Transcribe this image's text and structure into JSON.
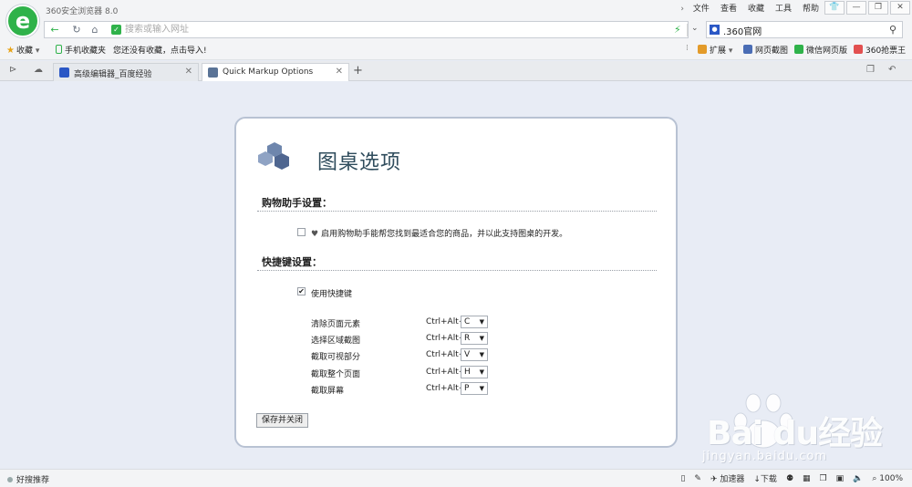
{
  "window": {
    "app_title": "360安全浏览器 8.0",
    "menu": [
      "文件",
      "查看",
      "收藏",
      "工具",
      "帮助"
    ]
  },
  "address": {
    "placeholder": "搜索或输入网址",
    "search_engine_text": ".360官网"
  },
  "bookmarks": {
    "favorites_label": "收藏",
    "mobile_label": "手机收藏夹",
    "hint": "您还没有收藏，点击导入!",
    "extensions_label": "扩展",
    "screenshot_label": "网页截图",
    "wechat_label": "微信网页版",
    "ticket_label": "360抢票王"
  },
  "tabs": [
    {
      "title": "高级编辑器_百度经验"
    },
    {
      "title": "Quick Markup Options"
    }
  ],
  "panel": {
    "title": "图桌选项",
    "shopping_section": "购物助手设置：",
    "shopping_option": "启用购物助手能帮您找到最适合您的商品，并以此支持图桌的开发。",
    "shortcut_section": "快捷键设置：",
    "use_shortcuts": "使用快捷键",
    "shortcuts": [
      {
        "label": "清除页面元素",
        "prefix": "Ctrl+Alt+",
        "key": "C"
      },
      {
        "label": "选择区域截图",
        "prefix": "Ctrl+Alt+",
        "key": "R"
      },
      {
        "label": "截取可视部分",
        "prefix": "Ctrl+Alt+",
        "key": "V"
      },
      {
        "label": "截取整个页面",
        "prefix": "Ctrl+Alt+",
        "key": "H"
      },
      {
        "label": "截取屏幕",
        "prefix": "Ctrl+Alt+",
        "key": "P"
      }
    ],
    "save_button": "保存并关闭"
  },
  "watermark": {
    "brand": "Bai du经验",
    "url": "jingyan.baidu.com"
  },
  "status": {
    "left": "好搜推荐",
    "accelerator": "加速器",
    "download": "下载",
    "zoom": "100%"
  }
}
